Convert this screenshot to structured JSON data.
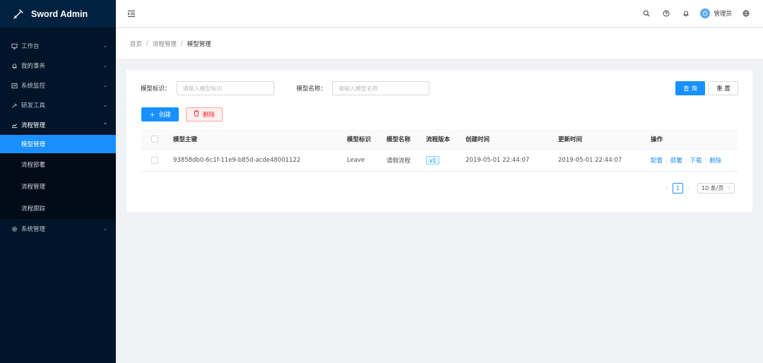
{
  "app": {
    "title": "Sword Admin",
    "logo_icon": "sword-icon"
  },
  "sidebar": {
    "items": [
      {
        "label": "工作台",
        "icon": "desktop-icon",
        "glyph": "▭"
      },
      {
        "label": "我的事务",
        "icon": "bell-icon",
        "glyph": "♢"
      },
      {
        "label": "系统监控",
        "icon": "monitor-icon",
        "glyph": "▣"
      },
      {
        "label": "研发工具",
        "icon": "tool-icon",
        "glyph": "✎"
      },
      {
        "label": "流程管理",
        "icon": "flow-chart-icon",
        "glyph": "⩘"
      },
      {
        "label": "系统管理",
        "icon": "settings-icon",
        "glyph": "⚙"
      }
    ],
    "submenu": [
      {
        "label": "模型管理"
      },
      {
        "label": "流程部署"
      },
      {
        "label": "流程管理"
      },
      {
        "label": "流程跟踪"
      }
    ]
  },
  "header": {
    "user_name": "管理员"
  },
  "breadcrumb": [
    "首页",
    "流程管理",
    "模型管理"
  ],
  "search": {
    "ident_label": "模型标识：",
    "ident_placeholder": "请输入模型标识",
    "name_label": "模型名称：",
    "name_placeholder": "请输入模型名称",
    "query_label": "查 询",
    "reset_label": "重 置"
  },
  "actions": {
    "create_label": "创建",
    "delete_label": "删除"
  },
  "table": {
    "columns": [
      "模型主键",
      "模型标识",
      "模型名称",
      "流程版本",
      "创建时间",
      "更新时间",
      "操作"
    ],
    "rows": [
      {
        "key": "93858db0-6c1f-11e9-b85d-acde48001122",
        "ident": "Leave",
        "name": "请假流程",
        "version": "v1",
        "created": "2019-05-01 22:44:07",
        "updated": "2019-05-01 22:44:07",
        "ops": [
          "配置",
          "部署",
          "下载",
          "删除"
        ]
      }
    ]
  },
  "pagination": {
    "current_page": "1",
    "page_size": "10 条/页"
  },
  "colors": {
    "primary": "#1890ff",
    "sidebar": "#001529",
    "danger": "#f5222d"
  }
}
